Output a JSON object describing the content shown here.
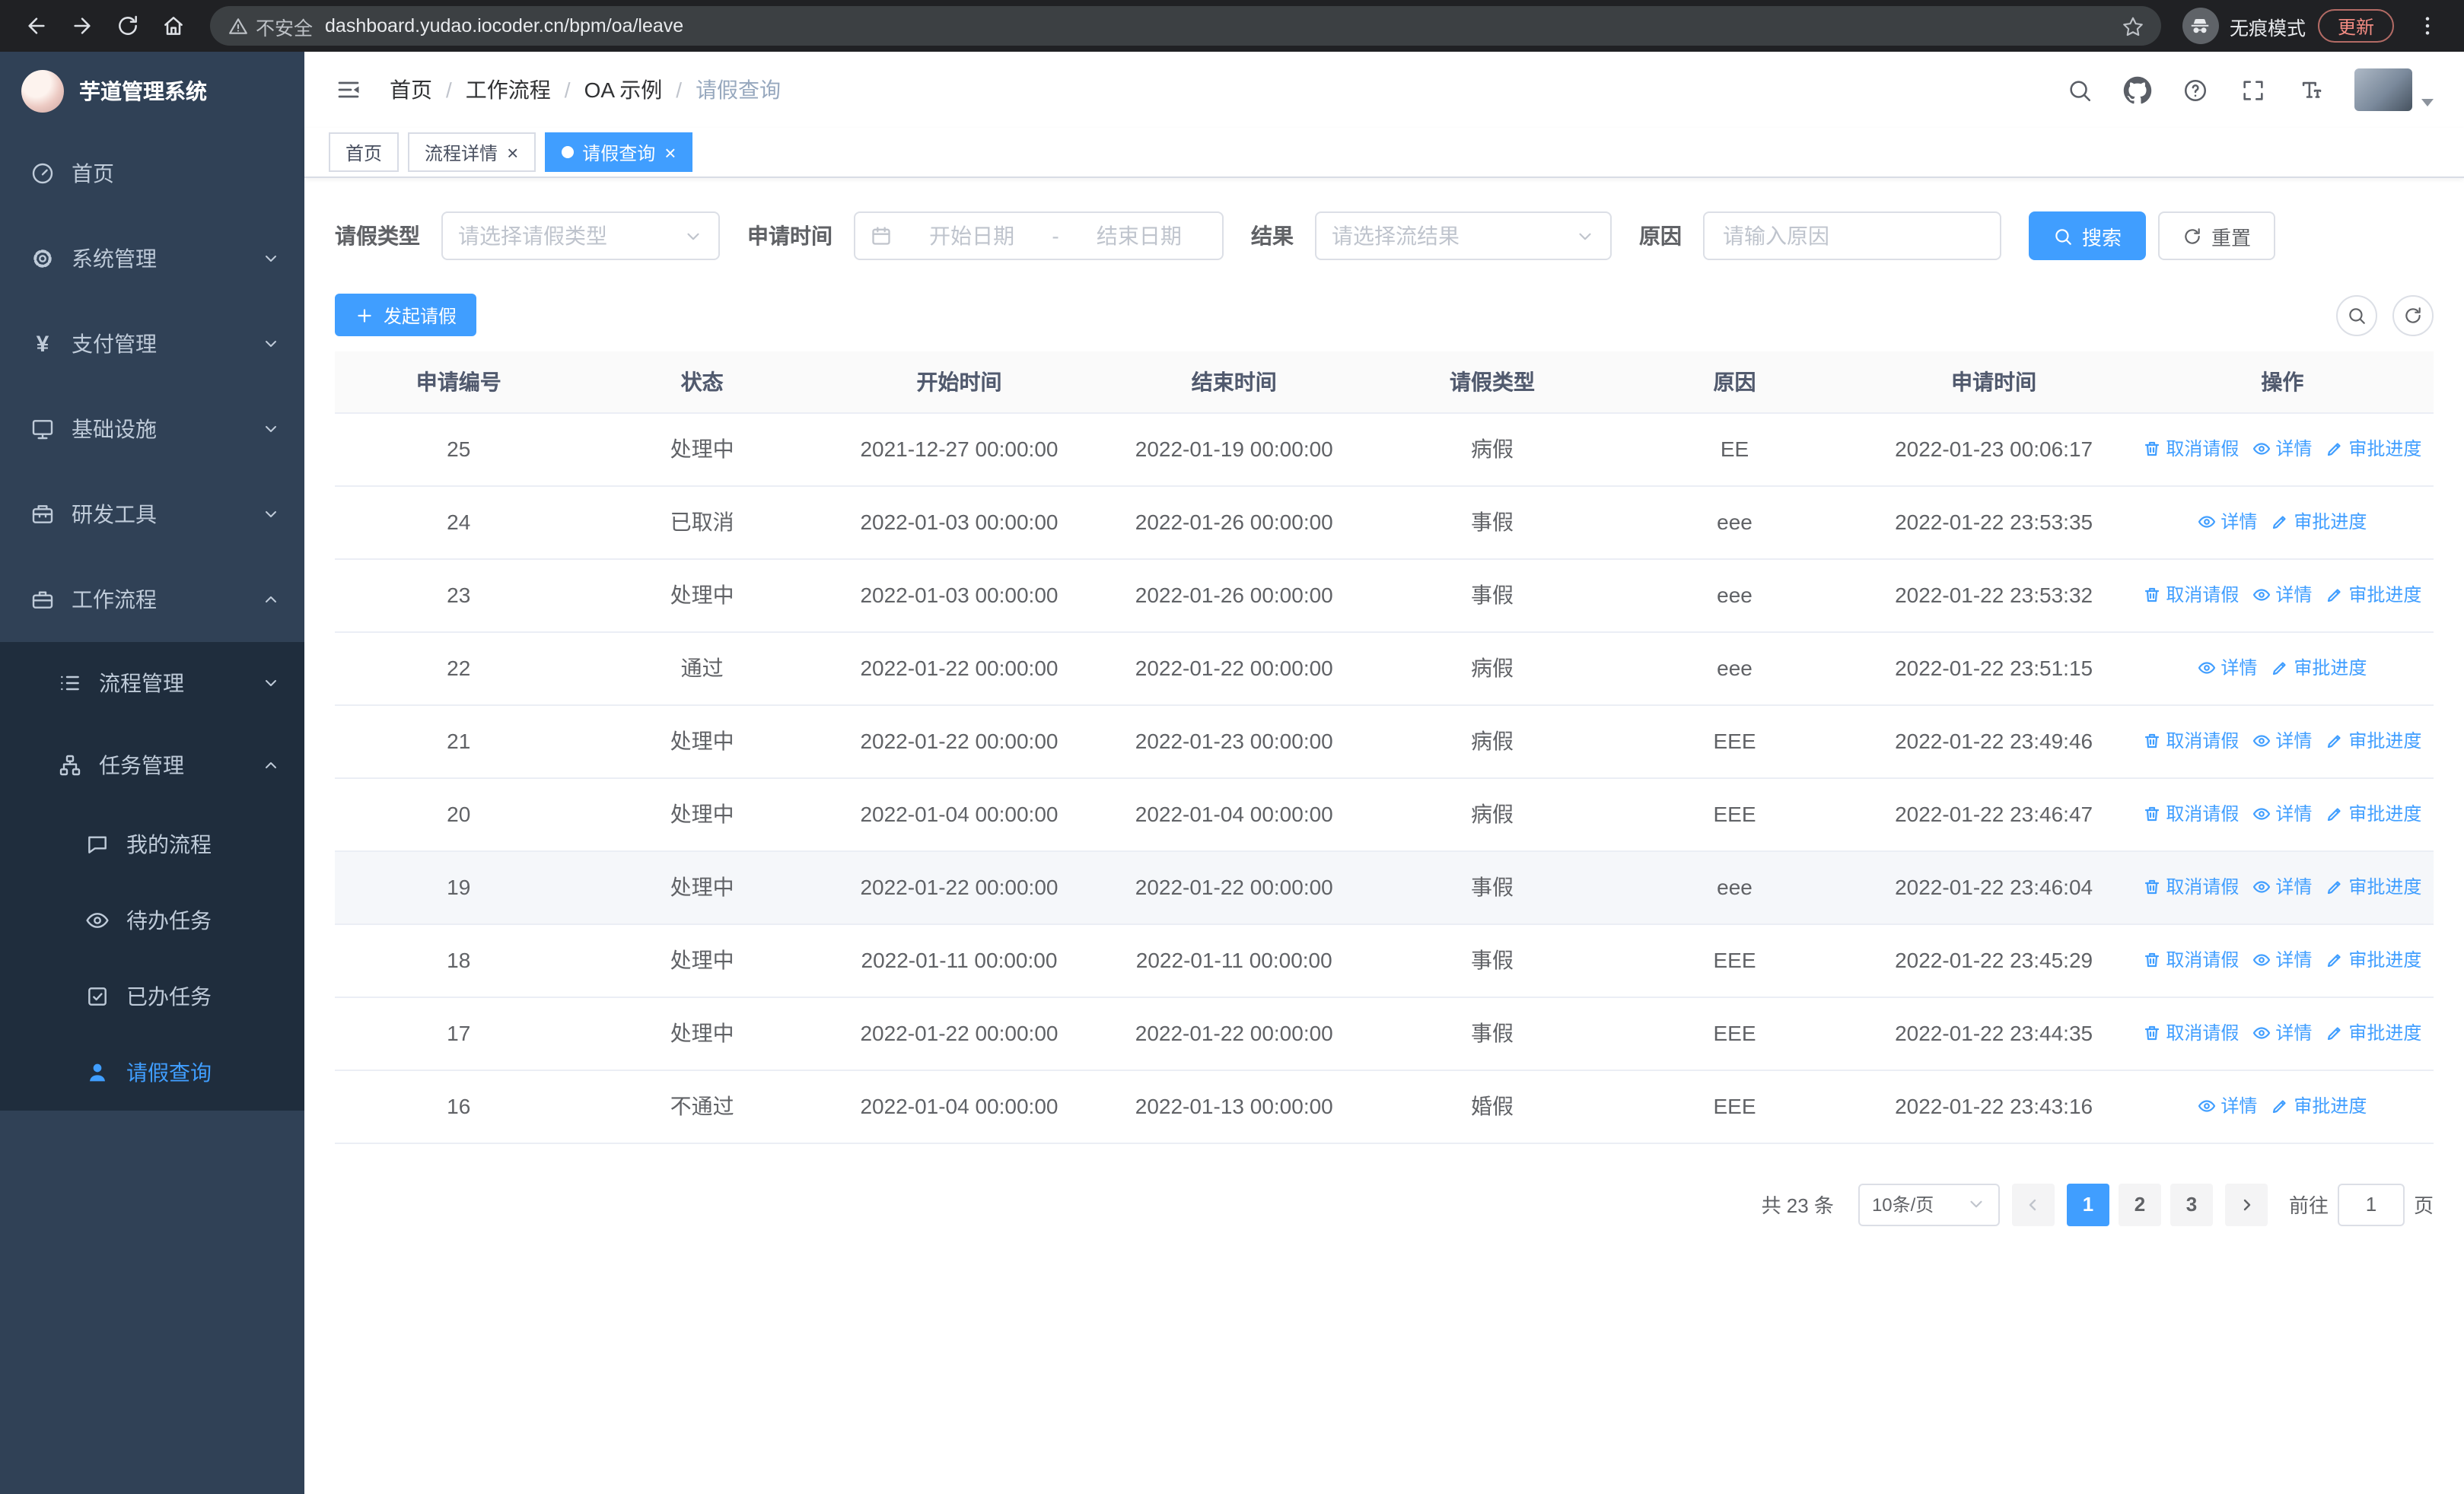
{
  "browser": {
    "security_label": "不安全",
    "url": "dashboard.yudao.iocoder.cn/bpm/oa/leave",
    "incognito_label": "无痕模式",
    "update_label": "更新"
  },
  "sidebar": {
    "logo_title": "芋道管理系统",
    "menu": [
      {
        "label": "首页",
        "icon": "dashboard-icon",
        "level": 1
      },
      {
        "label": "系统管理",
        "icon": "gear-icon",
        "level": 1,
        "chevron": "down"
      },
      {
        "label": "支付管理",
        "icon": "yen-icon",
        "level": 1,
        "chevron": "down"
      },
      {
        "label": "基础设施",
        "icon": "monitor-icon",
        "level": 1,
        "chevron": "down"
      },
      {
        "label": "研发工具",
        "icon": "toolbox-icon",
        "level": 1,
        "chevron": "down"
      },
      {
        "label": "工作流程",
        "icon": "briefcase-icon",
        "level": 1,
        "chevron": "up"
      },
      {
        "label": "流程管理",
        "icon": "list-icon",
        "level": 2,
        "chevron": "down"
      },
      {
        "label": "任务管理",
        "icon": "flow-icon",
        "level": 2,
        "chevron": "up"
      },
      {
        "label": "我的流程",
        "icon": "chat-icon",
        "level": 3
      },
      {
        "label": "待办任务",
        "icon": "eye-icon",
        "level": 3
      },
      {
        "label": "已办任务",
        "icon": "check-square-icon",
        "level": 3
      },
      {
        "label": "请假查询",
        "icon": "user-icon",
        "level": 3,
        "active": true
      }
    ]
  },
  "header": {
    "breadcrumb": [
      "首页",
      "工作流程",
      "OA 示例",
      "请假查询"
    ],
    "breadcrumb_separator": "/"
  },
  "tabs": [
    {
      "label": "首页",
      "closable": false,
      "active": false
    },
    {
      "label": "流程详情",
      "closable": true,
      "active": false
    },
    {
      "label": "请假查询",
      "closable": true,
      "active": true
    }
  ],
  "filters": {
    "leave_type_label": "请假类型",
    "leave_type_placeholder": "请选择请假类型",
    "apply_time_label": "申请时间",
    "start_date_placeholder": "开始日期",
    "range_separator": "-",
    "end_date_placeholder": "结束日期",
    "result_label": "结果",
    "result_placeholder": "请选择流结果",
    "reason_label": "原因",
    "reason_placeholder": "请输入原因",
    "search_button": "搜索",
    "reset_button": "重置"
  },
  "toolbar": {
    "create_button": "发起请假"
  },
  "table": {
    "columns": [
      "申请编号",
      "状态",
      "开始时间",
      "结束时间",
      "请假类型",
      "原因",
      "申请时间",
      "操作"
    ],
    "actions": {
      "cancel": "取消请假",
      "detail": "详情",
      "progress": "审批进度"
    },
    "rows": [
      {
        "id": "25",
        "status": "处理中",
        "start": "2021-12-27 00:00:00",
        "end": "2022-01-19 00:00:00",
        "type": "病假",
        "reason": "EE",
        "applied": "2022-01-23 00:06:17",
        "cancellable": true
      },
      {
        "id": "24",
        "status": "已取消",
        "start": "2022-01-03 00:00:00",
        "end": "2022-01-26 00:00:00",
        "type": "事假",
        "reason": "eee",
        "applied": "2022-01-22 23:53:35",
        "cancellable": false
      },
      {
        "id": "23",
        "status": "处理中",
        "start": "2022-01-03 00:00:00",
        "end": "2022-01-26 00:00:00",
        "type": "事假",
        "reason": "eee",
        "applied": "2022-01-22 23:53:32",
        "cancellable": true
      },
      {
        "id": "22",
        "status": "通过",
        "start": "2022-01-22 00:00:00",
        "end": "2022-01-22 00:00:00",
        "type": "病假",
        "reason": "eee",
        "applied": "2022-01-22 23:51:15",
        "cancellable": false
      },
      {
        "id": "21",
        "status": "处理中",
        "start": "2022-01-22 00:00:00",
        "end": "2022-01-23 00:00:00",
        "type": "病假",
        "reason": "EEE",
        "applied": "2022-01-22 23:49:46",
        "cancellable": true
      },
      {
        "id": "20",
        "status": "处理中",
        "start": "2022-01-04 00:00:00",
        "end": "2022-01-04 00:00:00",
        "type": "病假",
        "reason": "EEE",
        "applied": "2022-01-22 23:46:47",
        "cancellable": true
      },
      {
        "id": "19",
        "status": "处理中",
        "start": "2022-01-22 00:00:00",
        "end": "2022-01-22 00:00:00",
        "type": "事假",
        "reason": "eee",
        "applied": "2022-01-22 23:46:04",
        "cancellable": true,
        "highlighted": true
      },
      {
        "id": "18",
        "status": "处理中",
        "start": "2022-01-11 00:00:00",
        "end": "2022-01-11 00:00:00",
        "type": "事假",
        "reason": "EEE",
        "applied": "2022-01-22 23:45:29",
        "cancellable": true
      },
      {
        "id": "17",
        "status": "处理中",
        "start": "2022-01-22 00:00:00",
        "end": "2022-01-22 00:00:00",
        "type": "事假",
        "reason": "EEE",
        "applied": "2022-01-22 23:44:35",
        "cancellable": true
      },
      {
        "id": "16",
        "status": "不通过",
        "start": "2022-01-04 00:00:00",
        "end": "2022-01-13 00:00:00",
        "type": "婚假",
        "reason": "EEE",
        "applied": "2022-01-22 23:43:16",
        "cancellable": false
      }
    ]
  },
  "pagination": {
    "total_label": "共 23 条",
    "page_size_label": "10条/页",
    "pages": [
      "1",
      "2",
      "3"
    ],
    "active_page": "1",
    "goto_label": "前往",
    "goto_value": "1",
    "page_unit_label": "页"
  },
  "colors": {
    "primary": "#409eff",
    "sidebar_bg": "#304156",
    "submenu_bg": "#1f2d3d"
  }
}
